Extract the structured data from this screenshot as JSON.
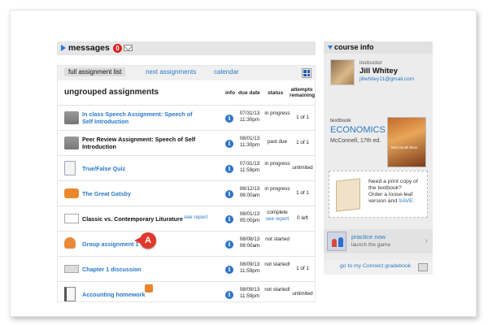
{
  "messages": {
    "title": "messages",
    "count": "0"
  },
  "tabs": [
    {
      "label": "full assignment list"
    },
    {
      "label": "next assignments"
    },
    {
      "label": "calendar"
    }
  ],
  "section_title": "ungrouped assignments",
  "columns": {
    "info": "info",
    "due": "due date",
    "status": "status",
    "attempts": "attempts remaining"
  },
  "rows": [
    {
      "name": "In class Speech Assignment: Speech of Self Introduction",
      "due": "07/31/13 11:30pm",
      "status": "in progress",
      "attempts": "1 of 1",
      "icon": "speech-icon"
    },
    {
      "name": "Peer Review Assignment: Speech of Self Introduction",
      "due": "08/01/13 11:30pm",
      "status": "past due",
      "attempts": "1 of 1",
      "icon": "speech-icon"
    },
    {
      "name": "True/False Quiz",
      "due": "07/31/13 11:59pm",
      "status": "in progress",
      "attempts": "unlimited",
      "icon": "document-icon"
    },
    {
      "name": "The Great Gatsby",
      "due": "08/12/13 06:00am",
      "status": "in progress",
      "attempts": "1 of 1",
      "icon": "chat-icon"
    },
    {
      "name": "Classic vs. Contemporary Liturature",
      "extra": "see report",
      "due": "08/01/13 05:00pm",
      "status": "complete",
      "status_link": "see report",
      "attempts": "0 left",
      "icon": "chart-icon"
    },
    {
      "name": "Group assignment 1",
      "due": "08/08/13 08:00am",
      "status": "not started",
      "attempts": "",
      "icon": "group-icon"
    },
    {
      "name": "Chapter 1 discussion",
      "due": "08/09/13 11:59pm",
      "status": "not started!",
      "attempts": "1 of 1",
      "icon": "discussion-icon"
    },
    {
      "name": "Accounting homework",
      "due": "08/09/13 11:59pm",
      "status": "not started!",
      "attempts": "unlimited",
      "icon": "notebook-icon"
    }
  ],
  "callout": "A",
  "course_info": {
    "title": "course info",
    "instructor_label": "instructor",
    "instructor_name": "Jill Whitey",
    "instructor_email": "jillwhitey11@gmail.com",
    "textbook_label": "textbook",
    "textbook_title": "ECONOMICS",
    "textbook_author": "McConnell, 17th ed.",
    "cover_text": "McConnell Brue",
    "print_q": "Need a print copy of the textbook?",
    "print_a": "Order a loose-leaf version and",
    "print_save": "SAVE."
  },
  "practice": {
    "title": "practice now",
    "subtitle": "launch the game"
  },
  "gradebook": {
    "label": "go to my Connect gradebook"
  }
}
